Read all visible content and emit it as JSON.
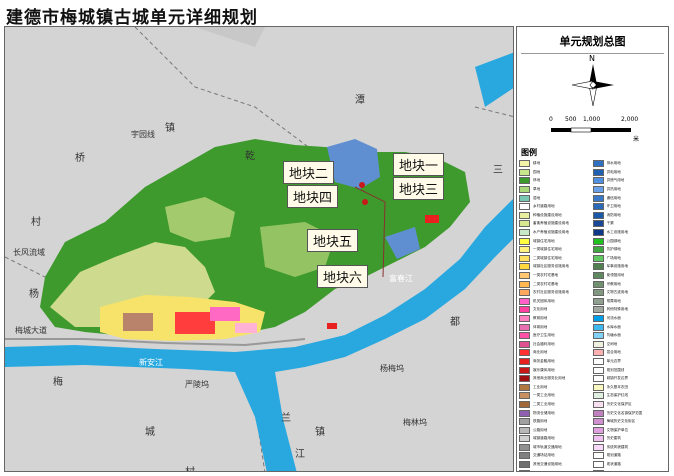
{
  "title": "建德市梅城镇古城单元详细规划",
  "legend_panel": {
    "title": "单元规划总图",
    "north": "N",
    "scale": {
      "ticks": [
        "0",
        "500",
        "1,000",
        "2,000"
      ],
      "unit": "米"
    },
    "legend_title": "图例",
    "items_left": [
      {
        "label": "耕地",
        "color": "#f2f2a8"
      },
      {
        "label": "园地",
        "color": "#c8e68c"
      },
      {
        "label": "林地",
        "color": "#3c9a2c"
      },
      {
        "label": "草地",
        "color": "#a8d878"
      },
      {
        "label": "湿地",
        "color": "#78c8b4"
      },
      {
        "label": "乡村道路用地",
        "color": "#ffffff"
      },
      {
        "label": "种植设施建设用地",
        "color": "#e8f0a0"
      },
      {
        "label": "畜禽养殖设施建设用地",
        "color": "#d8e890"
      },
      {
        "label": "水产养殖设施建设用地",
        "color": "#c8e8c8"
      },
      {
        "label": "城镇住宅用地",
        "color": "#ffff40"
      },
      {
        "label": "一类城镇住宅用地",
        "color": "#fff080"
      },
      {
        "label": "二类城镇住宅用地",
        "color": "#ffe060"
      },
      {
        "label": "城镇社区服务设施用地",
        "color": "#ffd840"
      },
      {
        "label": "一类农村宅基地",
        "color": "#ffc870"
      },
      {
        "label": "二类农村宅基地",
        "color": "#ffb850"
      },
      {
        "label": "农村社区服务设施用地",
        "color": "#ffa860"
      },
      {
        "label": "机关团体用地",
        "color": "#ff60c8"
      },
      {
        "label": "文化用地",
        "color": "#ff40a0"
      },
      {
        "label": "教育用地",
        "color": "#ff80c0"
      },
      {
        "label": "体育用地",
        "color": "#e870b0"
      },
      {
        "label": "医疗卫生用地",
        "color": "#ff50a8"
      },
      {
        "label": "社会福利用地",
        "color": "#e05090"
      },
      {
        "label": "商业用地",
        "color": "#ff3030"
      },
      {
        "label": "商务金融用地",
        "color": "#e82020"
      },
      {
        "label": "娱乐康体用地",
        "color": "#c81818"
      },
      {
        "label": "其他商业服务业用地",
        "color": "#a01010"
      },
      {
        "label": "工业用地",
        "color": "#b07840"
      },
      {
        "label": "一类工业用地",
        "color": "#c89060"
      },
      {
        "label": "二类工业用地",
        "color": "#a06838"
      },
      {
        "label": "物流仓储用地",
        "color": "#9060b0"
      },
      {
        "label": "铁路用地",
        "color": "#a0a0a0"
      },
      {
        "label": "公路用地",
        "color": "#b8b8b8"
      },
      {
        "label": "城镇道路用地",
        "color": "#d0d0d0"
      },
      {
        "label": "城市轨道交通用地",
        "color": "#909090"
      },
      {
        "label": "交通场站用地",
        "color": "#808080"
      },
      {
        "label": "其他交通设施用地",
        "color": "#707070"
      },
      {
        "label": "供水用地",
        "color": "#4080d0"
      }
    ],
    "items_right": [
      {
        "label": "排水用地",
        "color": "#3070c0"
      },
      {
        "label": "供电用地",
        "color": "#2060b0"
      },
      {
        "label": "供燃气用地",
        "color": "#5090e0"
      },
      {
        "label": "供热用地",
        "color": "#6aa0e8"
      },
      {
        "label": "通信用地",
        "color": "#3a78c8"
      },
      {
        "label": "环卫用地",
        "color": "#2a68b8"
      },
      {
        "label": "消防用地",
        "color": "#1a58a8"
      },
      {
        "label": "干渠",
        "color": "#1a4898"
      },
      {
        "label": "水工设施用地",
        "color": "#103888"
      },
      {
        "label": "公园绿地",
        "color": "#20c020"
      },
      {
        "label": "防护绿地",
        "color": "#40a840"
      },
      {
        "label": "广场用地",
        "color": "#60c860"
      },
      {
        "label": "军事设施用地",
        "color": "#508050"
      },
      {
        "label": "使领馆用地",
        "color": "#608860"
      },
      {
        "label": "宗教用地",
        "color": "#709070"
      },
      {
        "label": "文物古迹用地",
        "color": "#809880"
      },
      {
        "label": "殡葬用地",
        "color": "#90a090"
      },
      {
        "label": "其他特殊用地",
        "color": "#a0a8a0"
      },
      {
        "label": "河流水面",
        "color": "#00a0e8"
      },
      {
        "label": "水库水面",
        "color": "#40b8f0"
      },
      {
        "label": "坑塘水面",
        "color": "#80d0f8"
      },
      {
        "label": "空闲地",
        "color": "#f0f0e0"
      },
      {
        "label": "混合用地",
        "color": "#ffb0b0"
      },
      {
        "label": "单元边界",
        "color": "#ffffff"
      },
      {
        "label": "规划范围线",
        "color": "#ffffff"
      },
      {
        "label": "城镇开发边界",
        "color": "#ffffff"
      },
      {
        "label": "永久基本农田",
        "color": "#f8f8c0"
      },
      {
        "label": "生态保护红线",
        "color": "#e0f0e0"
      },
      {
        "label": "历史文化保护区",
        "color": "#f8e0f0"
      },
      {
        "label": "历史文化名镇保护范围",
        "color": "#c080c0"
      },
      {
        "label": "梅城历史文化街区",
        "color": "#d090d0"
      },
      {
        "label": "文物保护单位",
        "color": "#e0a0e0"
      },
      {
        "label": "历史建筑",
        "color": "#f0c0f0"
      },
      {
        "label": "传统风貌建筑",
        "color": "#f8d8f8"
      },
      {
        "label": "规划道路",
        "color": "#ffffff"
      },
      {
        "label": "现状道路",
        "color": "#ffffff"
      },
      {
        "label": "铁路线",
        "color": "#ffffff"
      }
    ]
  },
  "map": {
    "place_labels": [
      "镇",
      "潭",
      "乾",
      "桥",
      "村",
      "杨",
      "三",
      "都",
      "梅",
      "城",
      "镇",
      "兰",
      "江",
      "村"
    ],
    "road_labels": [
      "宇园线",
      "梅城大道",
      "严陵坞",
      "杨梅坞",
      "新安江",
      "富春江",
      "长风流域",
      "梅林坞"
    ],
    "plots": [
      "地块一",
      "地块二",
      "地块三",
      "地块四",
      "地块五",
      "地块六"
    ]
  }
}
